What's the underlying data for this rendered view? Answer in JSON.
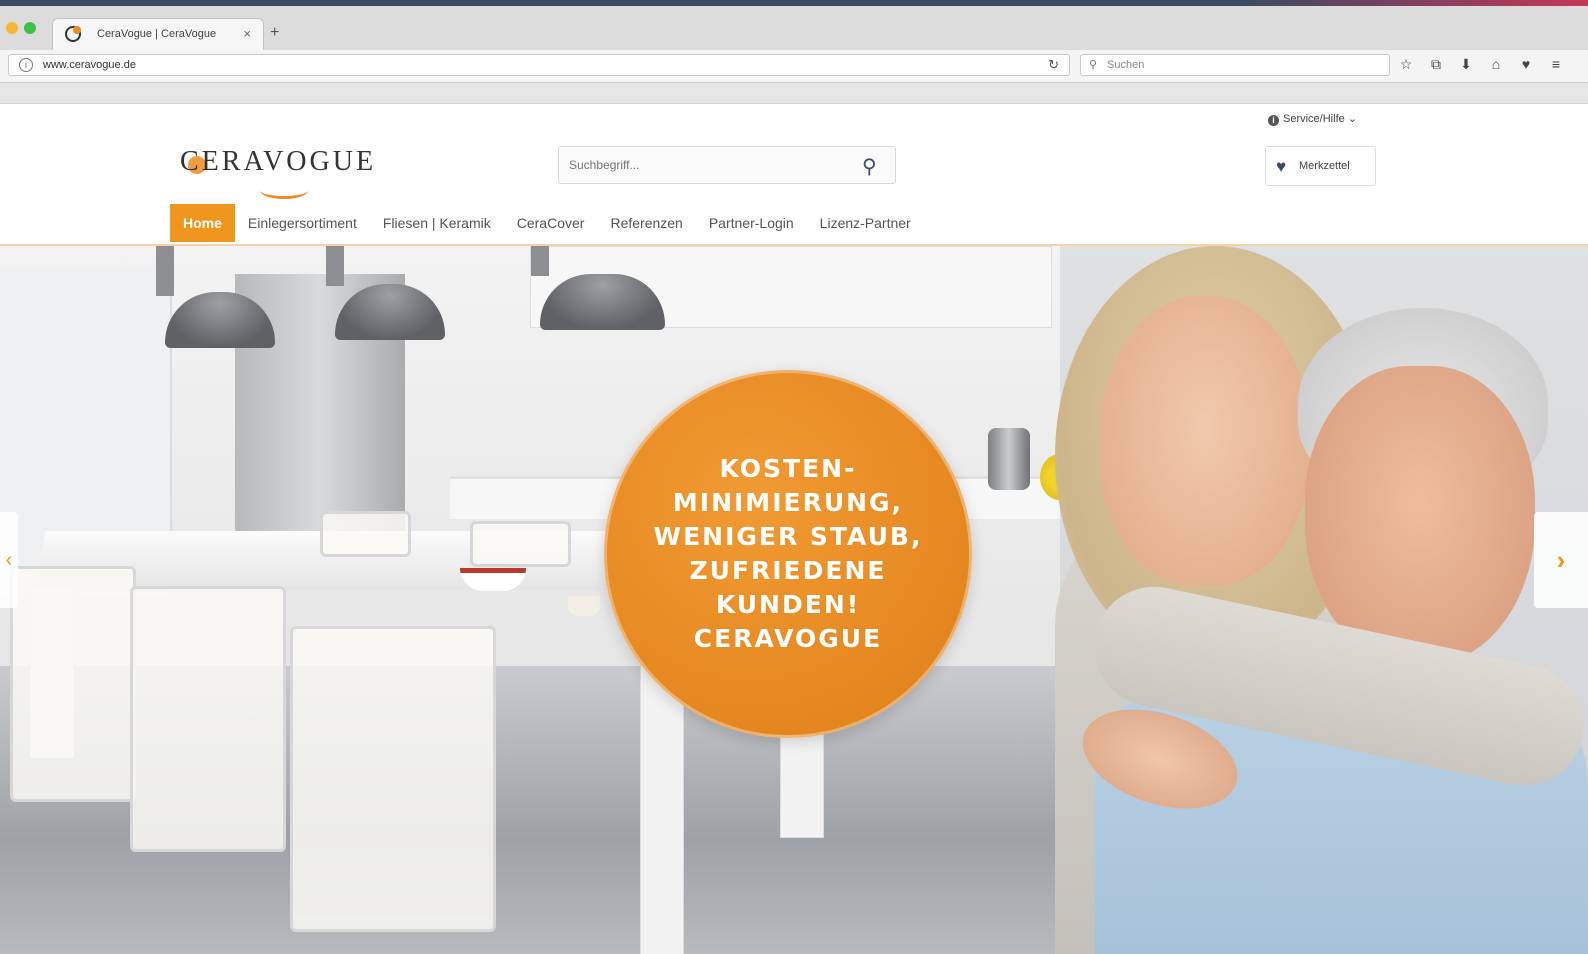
{
  "browser": {
    "tab_title": "CeraVogue | CeraVogue",
    "tab_close": "×",
    "new_tab": "+",
    "url_info_glyph": "i",
    "url": "www.ceravogue.de",
    "reload_glyph": "↻",
    "search_glyph": "⚲",
    "search_placeholder": "Suchen",
    "toolbar_icons": [
      "star-icon",
      "clipboard-icon",
      "download-icon",
      "home-icon",
      "pocket-icon",
      "menu-icon"
    ],
    "toolbar_glyphs": [
      "☆",
      "⧉",
      "⬇",
      "⌂",
      "♥",
      "≡"
    ]
  },
  "header": {
    "service_icon_glyph": "i",
    "service_label": "Service/Hilfe ⌄",
    "logo_text": "CERAVOGUE",
    "search_placeholder": "Suchbegriff...",
    "search_glyph": "⚲",
    "merkzettel_glyph": "♥",
    "merkzettel_label": "Merkzettel"
  },
  "nav": {
    "items": [
      "Home",
      "Einlegersortiment",
      "Fliesen | Keramik",
      "CeraCover",
      "Referenzen",
      "Partner-Login",
      "Lizenz-Partner"
    ],
    "active": "Home"
  },
  "hero": {
    "badge_text": "KOSTEN-\nMINIMIERUNG,\nWENIGER STAUB,\nZUFRIEDENE\nKUNDEN!\nCERAVOGUE",
    "arrow_left": "‹",
    "arrow_right": "›"
  },
  "colors": {
    "accent": "#f0951e",
    "badge": "#e8891f",
    "brand_dark": "#3a4a6b"
  }
}
